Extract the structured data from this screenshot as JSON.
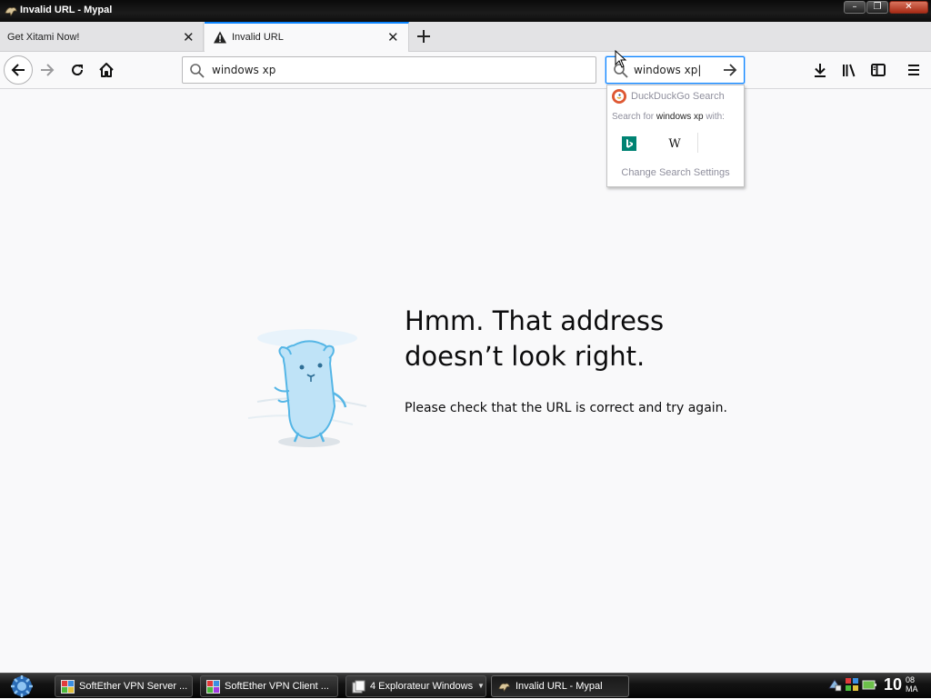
{
  "window": {
    "title": "Invalid URL - Mypal",
    "controls": {
      "minimize": "–",
      "maximize": "❐",
      "close": "✕"
    }
  },
  "tabs": [
    {
      "label": "Get Xitami Now!",
      "active": false
    },
    {
      "label": "Invalid URL",
      "active": true,
      "icon": "warning-icon"
    }
  ],
  "toolbar": {
    "url_value": "windows xp",
    "search_value": "windows xp|"
  },
  "search_popup": {
    "engine_label": "DuckDuckGo Search",
    "search_for_prefix": "Search for ",
    "query": "windows xp",
    "search_for_suffix": " with:",
    "engines": [
      "bing-icon",
      "wikipedia-icon"
    ],
    "wiki_glyph": "W",
    "settings_label": "Change Search Settings"
  },
  "error_page": {
    "title_line1": "Hmm. That address",
    "title_line2": "doesn’t look right.",
    "description": "Please check that the URL is correct and try again."
  },
  "taskbar": {
    "tasks": [
      {
        "label": "SoftEther VPN Server ..."
      },
      {
        "label": "SoftEther VPN Client ..."
      },
      {
        "label": "4  Explorateur Windows"
      },
      {
        "label": "Invalid URL - Mypal",
        "active": true
      }
    ],
    "clock": {
      "hour": "10",
      "minutes": "08",
      "ampm": "MA"
    }
  },
  "colors": {
    "accent": "#0a84ff",
    "page_bg": "#f9f9fa",
    "ddg": "#de5833",
    "bing": "#008373"
  }
}
